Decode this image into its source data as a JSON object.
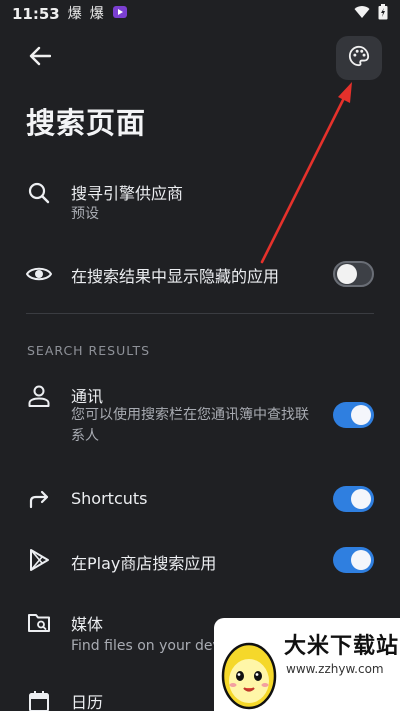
{
  "status_bar": {
    "time": "11:53",
    "app_icons": [
      "fire-icon",
      "fire-icon",
      "video-app-icon"
    ],
    "fire_glyph": "爆",
    "wifi": "wifi-icon",
    "battery": "battery-icon"
  },
  "header": {
    "back": "back-arrow-icon",
    "palette": "palette-icon"
  },
  "page": {
    "title": "搜索页面"
  },
  "settings": {
    "search_engine": {
      "title": "搜寻引擎供应商",
      "subtitle": "预设",
      "icon": "search-icon"
    },
    "show_hidden": {
      "title": "在搜索结果中显示隐藏的应用",
      "icon": "eye-icon",
      "enabled": false
    }
  },
  "section": {
    "header": "SEARCH RESULTS"
  },
  "results": {
    "contacts": {
      "title": "通讯",
      "subtitle": "您可以使用搜索栏在您通讯簿中查找联系人",
      "icon": "person-icon",
      "enabled": true
    },
    "shortcuts": {
      "title": "Shortcuts",
      "icon": "share-arrow-icon",
      "enabled": true
    },
    "play_store": {
      "title": "在Play商店搜索应用",
      "icon": "play-store-icon",
      "enabled": true
    },
    "media": {
      "title": "媒体",
      "subtitle": "Find files on your device",
      "icon": "folder-search-icon",
      "enabled": true
    },
    "calendar": {
      "title": "日历",
      "icon": "calendar-icon"
    }
  },
  "watermark": {
    "title": "大米下载站",
    "url": "www.zzhyw.com"
  },
  "colors": {
    "background": "#1f2023",
    "accent": "#2f7fe0",
    "annotation_arrow": "#e5312b"
  }
}
